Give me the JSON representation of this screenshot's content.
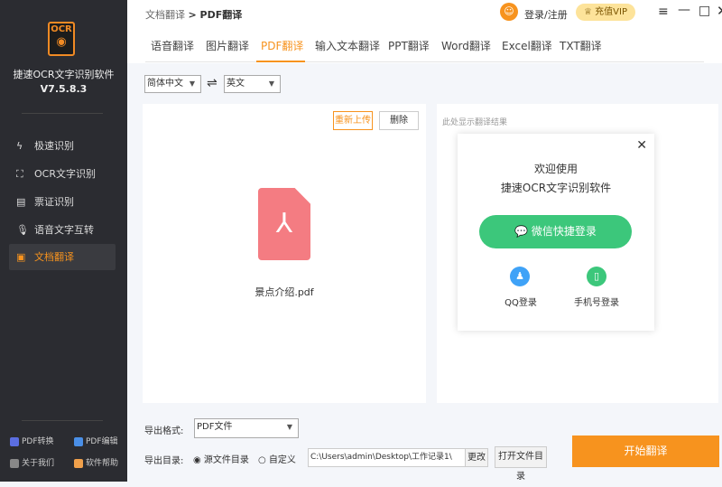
{
  "app": {
    "logo": "OCR",
    "name": "捷速OCR文字识别软件",
    "version": "V7.5.8.3"
  },
  "sidebar": {
    "items": [
      {
        "label": "极速识别",
        "icon": "lightning-icon"
      },
      {
        "label": "OCR文字识别",
        "icon": "scan-icon"
      },
      {
        "label": "票证识别",
        "icon": "ticket-icon"
      },
      {
        "label": "语音文字互转",
        "icon": "mic-icon"
      },
      {
        "label": "文档翻译",
        "icon": "document-icon",
        "active": true
      }
    ],
    "footer": [
      {
        "label": "PDF转换",
        "color": "#5b6ee1"
      },
      {
        "label": "PDF编辑",
        "color": "#4a8fe7"
      },
      {
        "label": "关于我们",
        "color": "#888888"
      },
      {
        "label": "软件帮助",
        "color": "#f0a04b"
      }
    ]
  },
  "header": {
    "breadcrumb_parent": "文档翻译",
    "breadcrumb_current": "> PDF翻译",
    "login": "登录/注册",
    "vip": "充值VIP"
  },
  "tabs": [
    "语音翻译",
    "图片翻译",
    "PDF翻译",
    "输入文本翻译",
    "PPT翻译",
    "Word翻译",
    "Excel翻译",
    "TXT翻译"
  ],
  "lang": {
    "source": "简体中文",
    "target": "英文"
  },
  "file": {
    "reupload": "重新上传",
    "delete": "删除",
    "name": "景点介绍.pdf"
  },
  "result": {
    "placeholder": "此处显示翻译结果"
  },
  "login_modal": {
    "line1": "欢迎使用",
    "line2": "捷速OCR文字识别软件",
    "wechat": "微信快捷登录",
    "qq": "QQ登录",
    "phone": "手机号登录"
  },
  "export": {
    "format_label": "导出格式:",
    "format": "PDF文件",
    "dir_label": "导出目录:",
    "opt_source": "源文件目录",
    "opt_custom": "自定义",
    "path": "C:\\Users\\admin\\Desktop\\工作记录1\\",
    "change": "更改",
    "open_dir": "打开文件目录",
    "start": "开始翻译"
  },
  "colors": {
    "accent": "#f7931e",
    "wechat": "#3cc77b"
  }
}
